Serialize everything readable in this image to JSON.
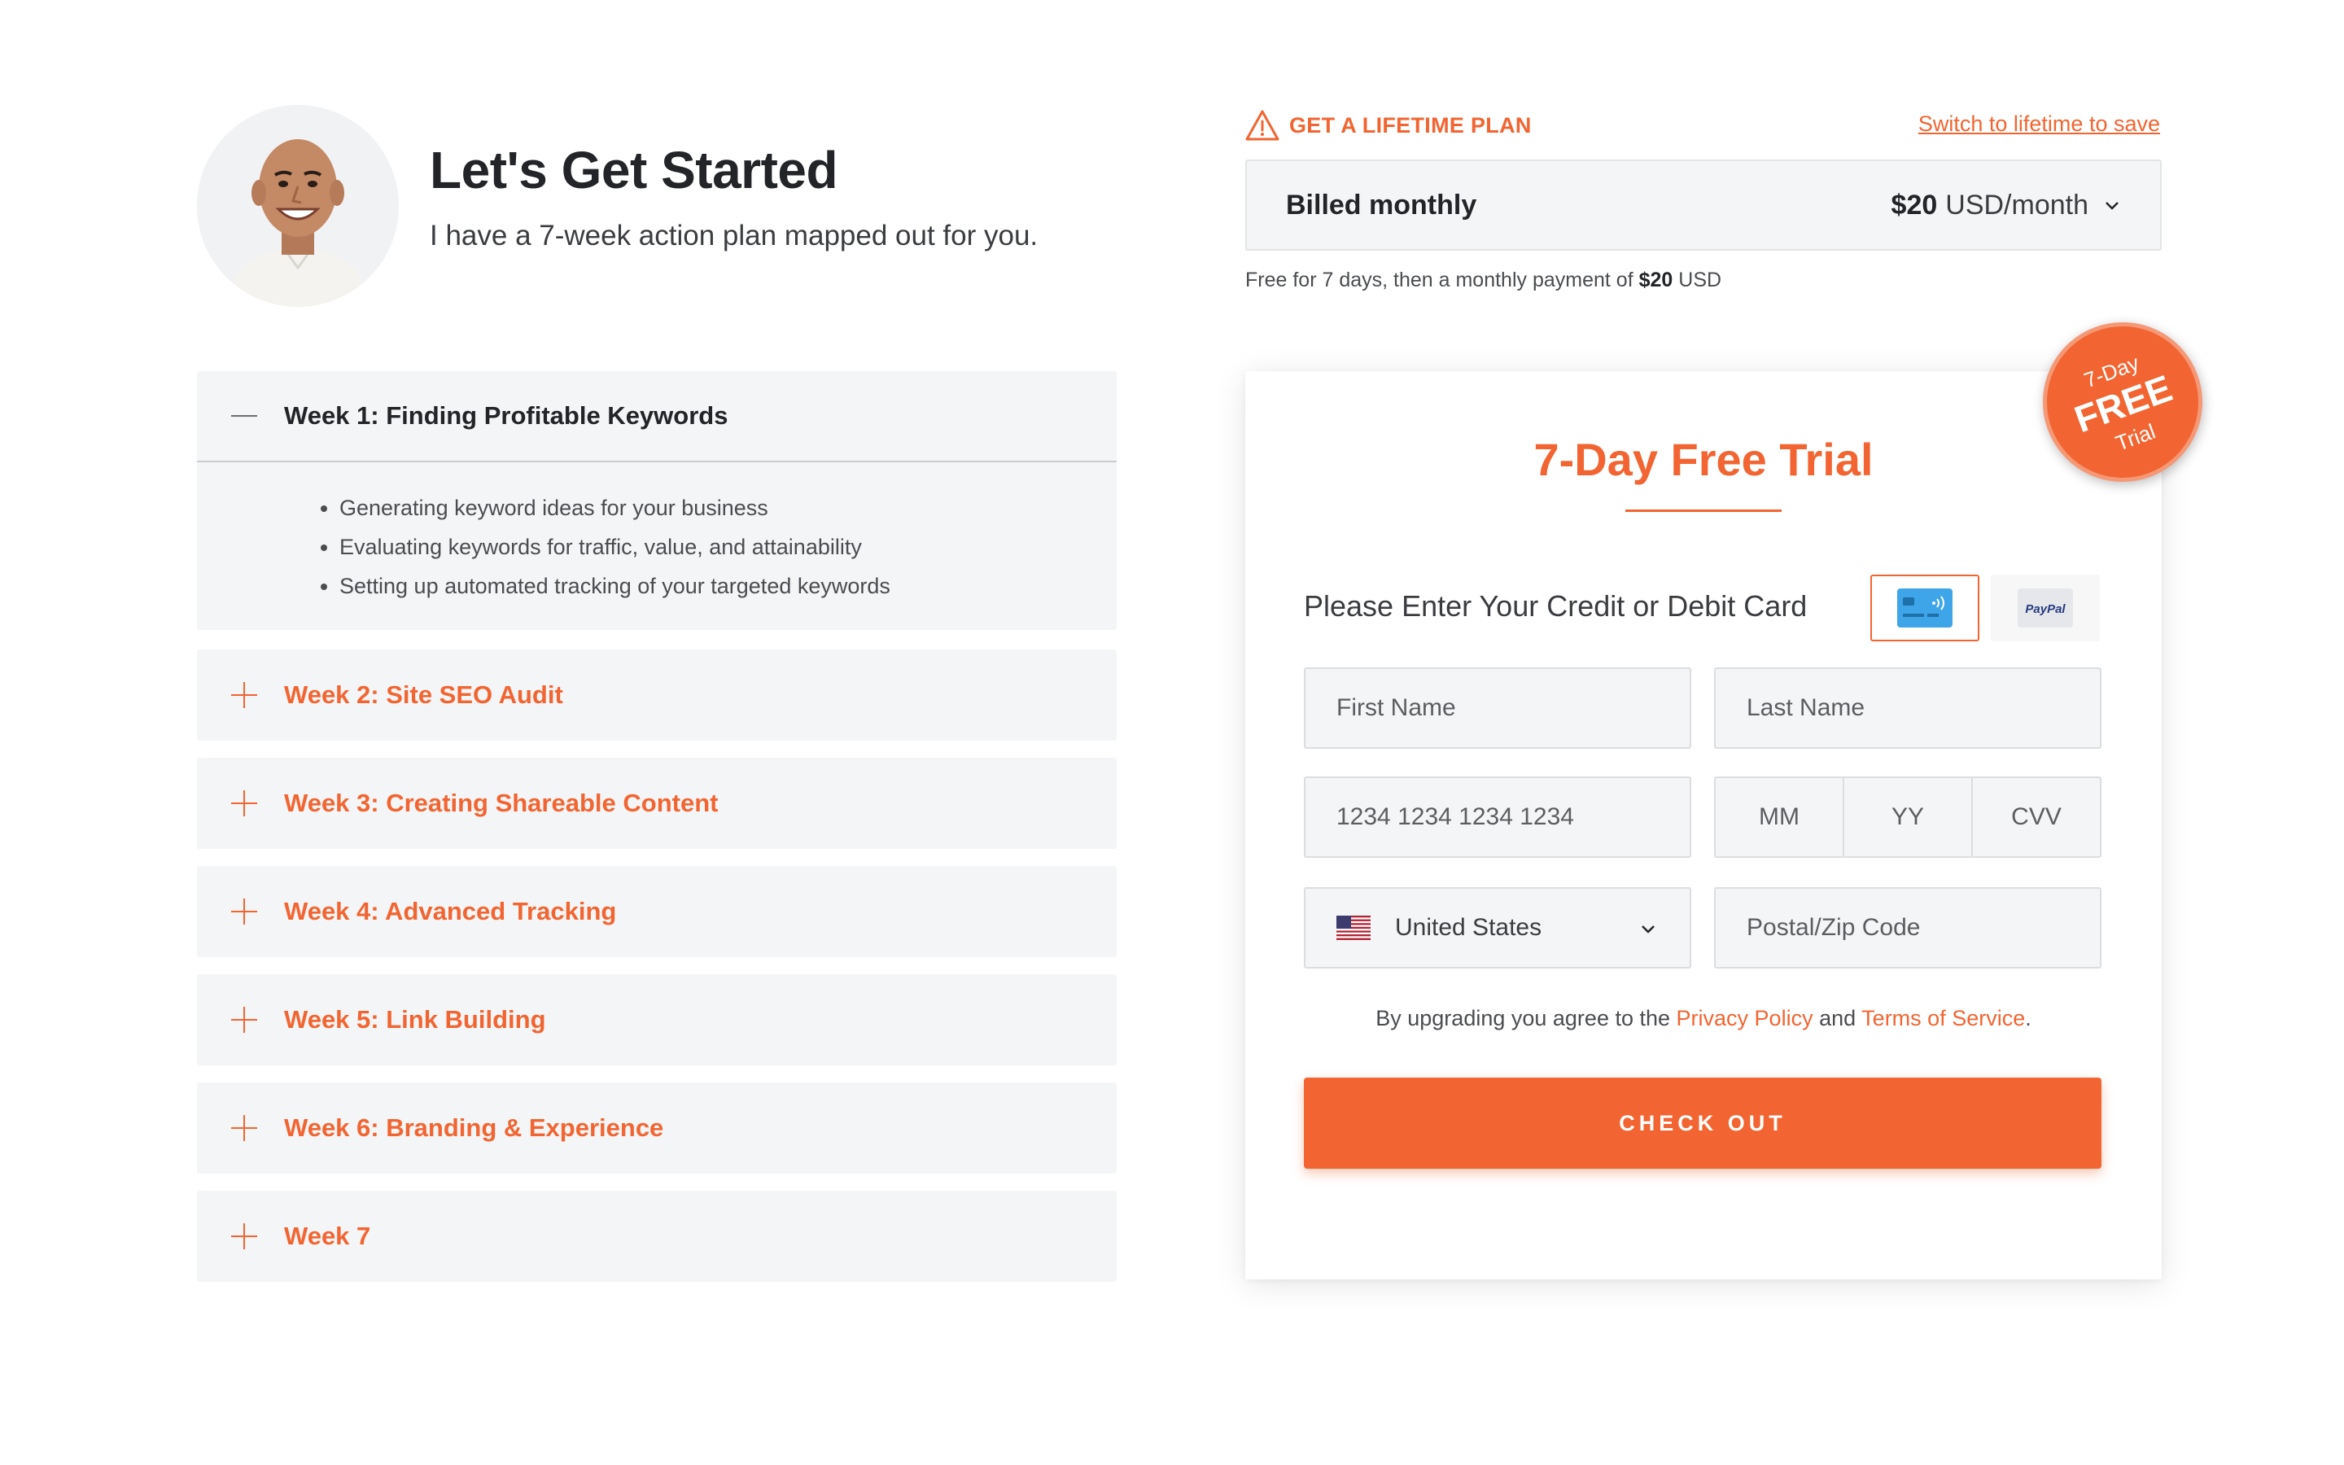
{
  "hero": {
    "title": "Let's Get Started",
    "subtitle": "I have a 7-week action plan mapped out for you."
  },
  "weeks": [
    {
      "label": "Week 1: Finding Profitable Keywords",
      "expanded": true,
      "bullets": [
        "Generating keyword ideas for your business",
        "Evaluating keywords for traffic, value, and attainability",
        "Setting up automated tracking of your targeted keywords"
      ]
    },
    {
      "label": "Week 2: Site SEO Audit",
      "expanded": false
    },
    {
      "label": "Week 3: Creating Shareable Content",
      "expanded": false
    },
    {
      "label": "Week 4: Advanced Tracking",
      "expanded": false
    },
    {
      "label": "Week 5: Link Building",
      "expanded": false
    },
    {
      "label": "Week 6: Branding & Experience",
      "expanded": false
    },
    {
      "label": "Week 7",
      "expanded": false
    }
  ],
  "plan": {
    "lifetime_label": "GET A LIFETIME PLAN",
    "switch_link": "Switch to lifetime to save",
    "billing_cycle": "Billed monthly",
    "price": "$20",
    "price_unit": "USD/month",
    "note_prefix": "Free for 7 days, then a monthly payment of",
    "note_amount": "$20",
    "note_suffix": "USD"
  },
  "checkout": {
    "title": "7-Day Free Trial",
    "badge": {
      "line1": "7-Day",
      "line2": "FREE",
      "line3": "Trial"
    },
    "payment_label": "Please Enter Your Credit or Debit Card",
    "paypal_label": "PayPal",
    "fields": {
      "first_name": "First Name",
      "last_name": "Last Name",
      "card_number": "1234 1234 1234 1234",
      "month": "MM",
      "year": "YY",
      "cvv": "CVV",
      "country": "United States",
      "postal": "Postal/Zip Code"
    },
    "agree_prefix": "By upgrading you agree to the",
    "privacy": "Privacy Policy",
    "agree_and": "and",
    "terms": "Terms of Service",
    "agree_end": ".",
    "button": "CHECK OUT"
  },
  "colors": {
    "accent": "#f26532",
    "panel": "#f4f5f6",
    "text": "#222428"
  },
  "icons": [
    "avatar",
    "minus-icon",
    "plus-icon",
    "warning-icon",
    "chevron-down-icon",
    "credit-card-icon",
    "paypal-icon",
    "us-flag-icon"
  ]
}
